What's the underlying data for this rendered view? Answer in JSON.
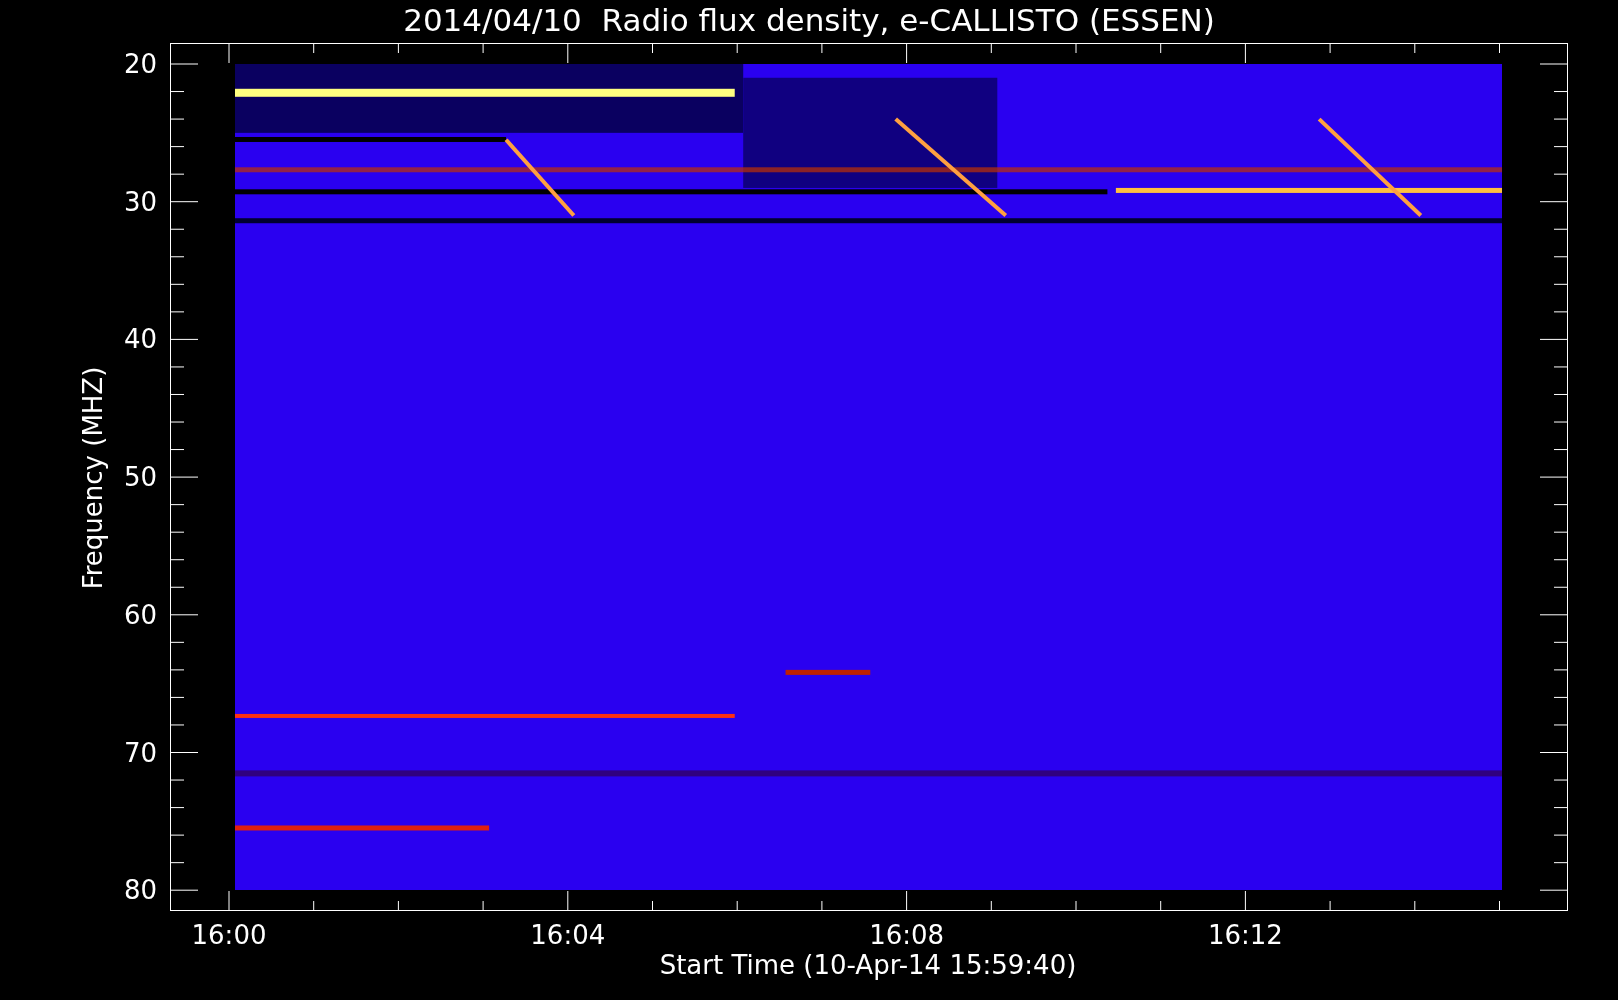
{
  "title": "2014/04/10  Radio flux density, e-CALLISTO (ESSEN)",
  "y_axis": {
    "label": "Frequency (MHZ)",
    "ticks": [
      "20",
      "30",
      "40",
      "50",
      "60",
      "70",
      "80"
    ]
  },
  "x_axis": {
    "label": "Start Time (10-Apr-14 15:59:40)",
    "ticks": [
      "16:00",
      "16:04",
      "16:08",
      "16:12"
    ]
  }
}
